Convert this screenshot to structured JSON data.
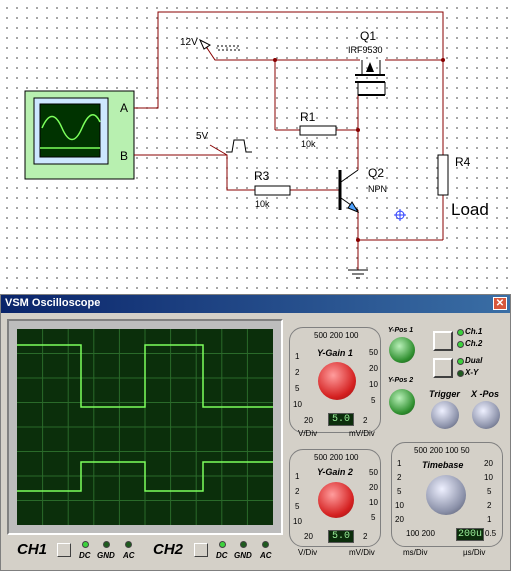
{
  "schematic": {
    "supply_label": "12V",
    "pulse_label": "5V",
    "q1_name": "Q1",
    "q1_part": "IRF9530",
    "q2_name": "Q2",
    "q2_type": "NPN",
    "r1_name": "R1",
    "r1_value": "10k",
    "r3_name": "R3",
    "r3_value": "10k",
    "r4_name": "R4",
    "load_label": "Load",
    "scope_pin_a": "A",
    "scope_pin_b": "B"
  },
  "window": {
    "title": "VSM Oscilloscope",
    "close_symbol": "✕"
  },
  "channels": {
    "ch1_label": "CH1",
    "ch2_label": "CH2",
    "coupling": [
      "DC",
      "GND",
      "AC"
    ]
  },
  "ygain1": {
    "title": "Y-Gain 1",
    "top_scale": "500 200 100",
    "left_scale": [
      "1",
      "2",
      "5",
      "10",
      "20"
    ],
    "right_scale": [
      "50",
      "20",
      "10",
      "5",
      "2"
    ],
    "readout": "5.0",
    "unit_left": "V/Div",
    "unit_right": "mV/Div"
  },
  "ygain2": {
    "title": "Y-Gain 2",
    "top_scale": "500 200 100",
    "left_scale": [
      "1",
      "2",
      "5",
      "10",
      "20"
    ],
    "right_scale": [
      "50",
      "20",
      "10",
      "5",
      "2"
    ],
    "readout": "5.0",
    "unit_left": "V/Div",
    "unit_right": "mV/Div"
  },
  "ypos": {
    "pos1": "Y-Pos 1",
    "pos2": "Y-Pos 2"
  },
  "mode": {
    "ch1": "Ch.1",
    "ch2": "Ch.2",
    "dual": "Dual",
    "xy": "X-Y"
  },
  "trigger": {
    "label": "Trigger",
    "xpos": "X -Pos"
  },
  "timebase": {
    "title": "Timebase",
    "top_scale": "500 200 100 50",
    "left_scale": [
      "1",
      "2",
      "5",
      "10",
      "20",
      "50"
    ],
    "right_scale": [
      "20",
      "10",
      "5",
      "2",
      "1",
      "0.5"
    ],
    "bottom_left": "100 200",
    "readout": "200u",
    "unit_left": "ms/Div",
    "unit_right": "µs/Div"
  },
  "colors": {
    "screen": "#0b2f0b",
    "trace": "#7cff5c",
    "grid": "#2a6a2a",
    "knob_red": "#e03030",
    "knob_green": "#2f8f2f",
    "knob_gray": "#8a90a8",
    "title_bar": "#0a246a"
  }
}
